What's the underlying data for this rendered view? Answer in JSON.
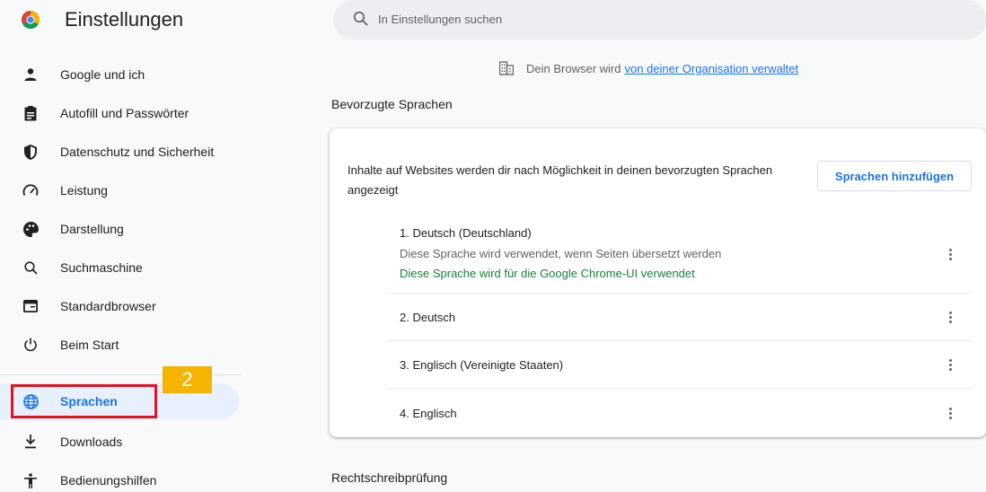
{
  "app": {
    "title": "Einstellungen"
  },
  "search": {
    "placeholder": "In Einstellungen suchen"
  },
  "sidebar": {
    "items": [
      {
        "label": "Google und ich",
        "icon": "person-icon"
      },
      {
        "label": "Autofill und Passwörter",
        "icon": "clipboard-icon"
      },
      {
        "label": "Datenschutz und Sicherheit",
        "icon": "shield-icon"
      },
      {
        "label": "Leistung",
        "icon": "speedometer-icon"
      },
      {
        "label": "Darstellung",
        "icon": "palette-icon"
      },
      {
        "label": "Suchmaschine",
        "icon": "search-icon"
      },
      {
        "label": "Standardbrowser",
        "icon": "browser-window-icon"
      },
      {
        "label": "Beim Start",
        "icon": "power-icon"
      },
      {
        "label": "Sprachen",
        "icon": "globe-icon",
        "active": true
      },
      {
        "label": "Downloads",
        "icon": "download-icon"
      },
      {
        "label": "Bedienungshilfen",
        "icon": "accessibility-icon"
      }
    ]
  },
  "annotation": {
    "badge": "2"
  },
  "managed_notice": {
    "text": "Dein Browser wird",
    "link": "von deiner Organisation verwaltet"
  },
  "sections": {
    "preferred_languages": "Bevorzugte Sprachen",
    "spellcheck": "Rechtschreibprüfung"
  },
  "languages_card": {
    "description": "Inhalte auf Websites werden dir nach Möglichkeit in deinen bevorzugten Sprachen angezeigt",
    "add_button": "Sprachen hinzufügen",
    "languages": [
      {
        "name": "1. Deutsch (Deutschland)",
        "sub": "Diese Sprache wird verwendet, wenn Seiten übersetzt werden",
        "ui_note": "Diese Sprache wird für die Google Chrome-UI verwendet"
      },
      {
        "name": "2. Deutsch"
      },
      {
        "name": "3. Englisch (Vereinigte Staaten)"
      },
      {
        "name": "4. Englisch"
      }
    ]
  },
  "colors": {
    "accent": "#1a73e8",
    "success": "#188038",
    "highlight": "#e8101c",
    "badge": "#f4b400"
  }
}
